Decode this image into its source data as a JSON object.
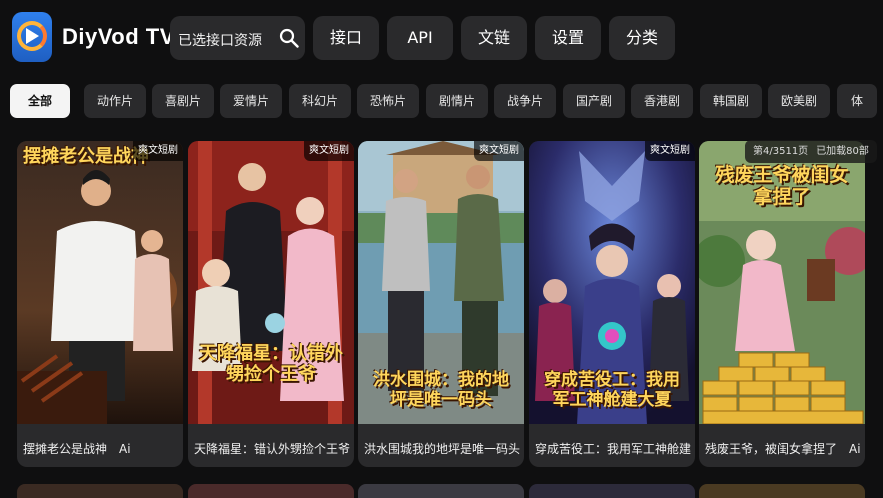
{
  "header": {
    "app_title": "DiyVod TV",
    "search_placeholder": "已选接口资源",
    "buttons": [
      "接口",
      "API",
      "文链",
      "设置",
      "分类"
    ]
  },
  "categories": [
    {
      "label": "全部",
      "active": true
    },
    {
      "label": "动作片"
    },
    {
      "label": "喜剧片"
    },
    {
      "label": "爱情片"
    },
    {
      "label": "科幻片"
    },
    {
      "label": "恐怖片"
    },
    {
      "label": "剧情片"
    },
    {
      "label": "战争片"
    },
    {
      "label": "国产剧"
    },
    {
      "label": "香港剧"
    },
    {
      "label": "韩国剧"
    },
    {
      "label": "欧美剧"
    },
    {
      "label": "体"
    }
  ],
  "pagination": {
    "page": "第4/3511页",
    "loaded": "已加载80部"
  },
  "videos": [
    {
      "badge": "爽文短剧",
      "poster_title": "摆摊老公是战神",
      "caption": "摆摊老公是战神　Ai"
    },
    {
      "badge": "爽文短剧",
      "poster_title": "天降福星：认错外甥捡个王爷",
      "caption": "天降福星：错认外甥捡个王爷..."
    },
    {
      "badge": "爽文短剧",
      "poster_title": "洪水围城：我的地坪是唯一码头",
      "caption": "洪水围城我的地坪是唯一码头　Ai"
    },
    {
      "badge": "爽文短剧",
      "poster_title": "穿成苦役工：我用军工神舱建大夏",
      "caption": "穿成苦役工：我用军工神舱建..."
    },
    {
      "badge": "",
      "poster_title": "残废王爷被闺女拿捏了",
      "caption": "残废王爷，被闺女拿捏了　Ai"
    }
  ],
  "colors": {
    "background": "#0f0f10",
    "surface": "#2a2a2c",
    "active_chip": "#f4f4f4",
    "poster_title": "#ffd65c"
  }
}
